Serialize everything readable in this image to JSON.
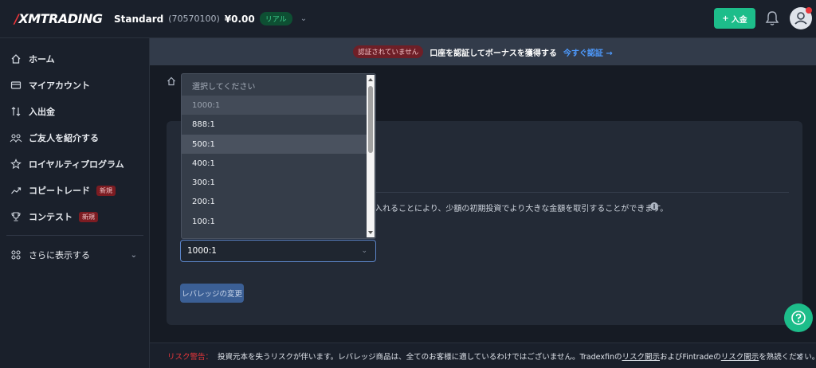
{
  "header": {
    "logo": "XMTRADING",
    "account_type": "Standard",
    "account_number": "(70570100)",
    "balance": "¥0.00",
    "account_badge": "リアル",
    "deposit_label": "入金"
  },
  "sidebar": {
    "items": [
      {
        "label": "ホーム",
        "icon": "home-icon"
      },
      {
        "label": "マイアカウント",
        "icon": "card-icon"
      },
      {
        "label": "入出金",
        "icon": "transfer-icon"
      },
      {
        "label": "ご友人を紹介する",
        "icon": "people-icon"
      },
      {
        "label": "ロイヤルティプログラム",
        "icon": "star-icon"
      },
      {
        "label": "コピートレード",
        "icon": "trend-icon",
        "tag": "新規"
      },
      {
        "label": "コンテスト",
        "icon": "trophy-icon",
        "tag": "新規"
      }
    ],
    "more_label": "さらに表示する"
  },
  "banner": {
    "status": "認証されていません",
    "message": "口座を認証してボーナスを獲得する",
    "link": "今すぐ認証 →"
  },
  "leverage": {
    "description": "入れることにより、少額の初期投資でより大きな金額を取引することができます。",
    "selected": "1000:1",
    "options": [
      "選択してください",
      "1000:1",
      "888:1",
      "500:1",
      "400:1",
      "300:1",
      "200:1",
      "100:1"
    ],
    "change_button": "レバレッジの変更"
  },
  "risk": {
    "label": "リスク警告：",
    "text1": "投資元本を失うリスクが伴います。レバレッジ商品は、全てのお客様に適しているわけではございません。Tradexfinの",
    "link1": "リスク開示",
    "text2": "およびFintradeの",
    "link2": "リスク開示",
    "text3": "を熟読ください。"
  },
  "colors": {
    "accent_green": "#1dbd8a",
    "link_blue": "#4e9bff",
    "danger_red": "#e8363b"
  }
}
